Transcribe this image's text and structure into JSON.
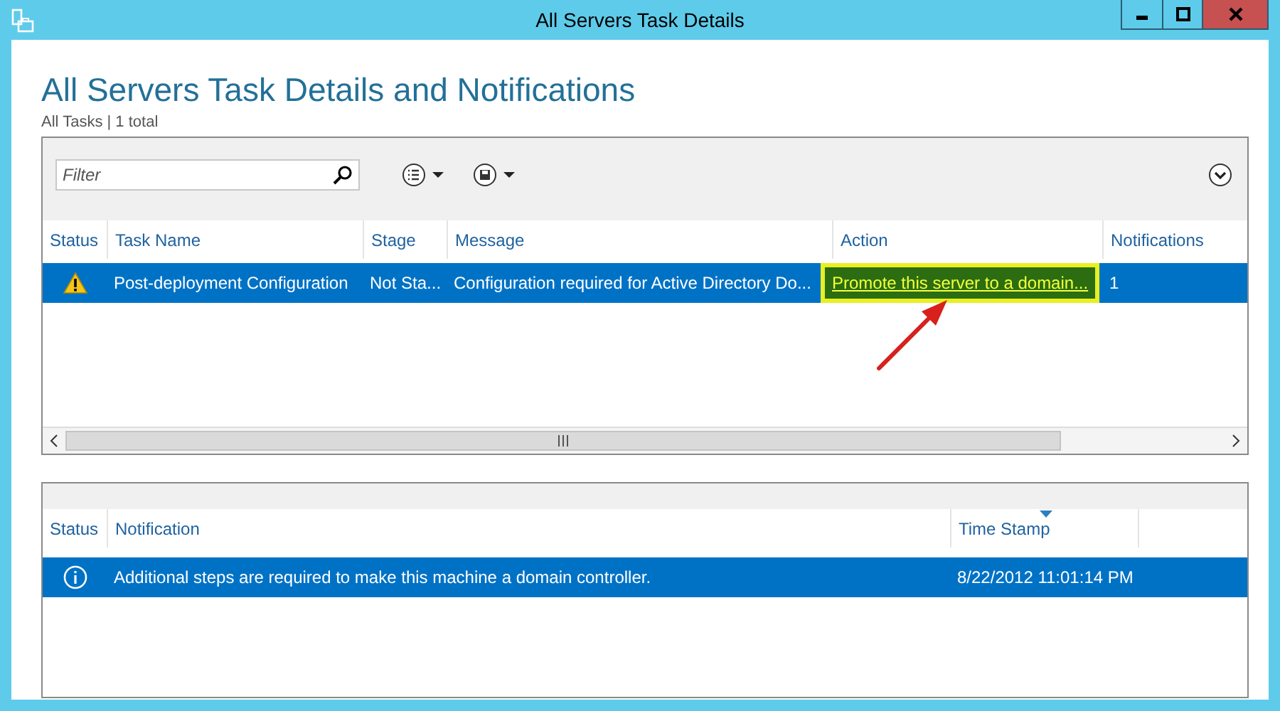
{
  "window": {
    "title": "All Servers Task Details"
  },
  "heading": "All Servers Task Details and Notifications",
  "summary": "All Tasks | 1 total",
  "filter": {
    "placeholder": "Filter"
  },
  "tasks": {
    "columns": [
      {
        "label": "Status"
      },
      {
        "label": "Task Name"
      },
      {
        "label": "Stage"
      },
      {
        "label": "Message"
      },
      {
        "label": "Action"
      },
      {
        "label": "Notifications"
      }
    ],
    "rows": [
      {
        "kind": "warning",
        "task_name": "Post-deployment Configuration",
        "stage": "Not Sta...",
        "message": "Configuration required for Active Directory Do...",
        "action": "Promote this server to a domain...",
        "action_highlighted": true,
        "notifications": "1",
        "selected": true
      }
    ]
  },
  "notifications": {
    "columns": [
      {
        "label": "Status",
        "sorted": false
      },
      {
        "label": "Notification",
        "sorted": false
      },
      {
        "label": "Time Stamp",
        "sorted": true
      }
    ],
    "rows": [
      {
        "kind": "info",
        "notification": "Additional steps are required to make this machine a domain controller.",
        "time_stamp": "8/22/2012 11:01:14 PM",
        "selected": true
      }
    ]
  }
}
